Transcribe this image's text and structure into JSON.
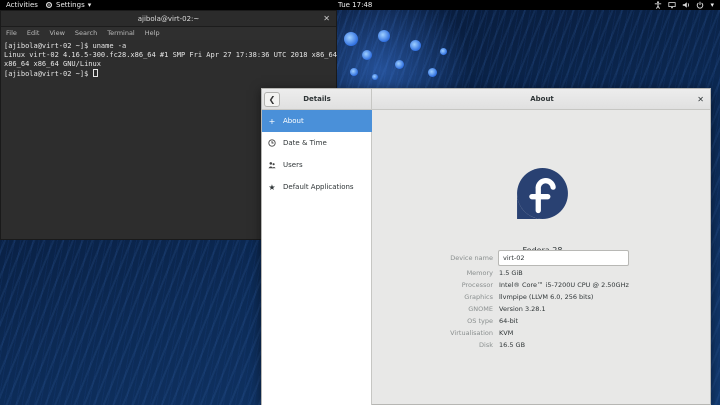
{
  "topbar": {
    "activities": "Activities",
    "app_menu": "Settings",
    "clock": "Tue 17:48"
  },
  "terminal": {
    "title": "ajibola@virt-02:~",
    "menu": [
      "File",
      "Edit",
      "View",
      "Search",
      "Terminal",
      "Help"
    ],
    "lines": [
      "[ajibola@virt-02 ~]$ uname -a",
      "Linux virt-02 4.16.5-300.fc28.x86_64 #1 SMP Fri Apr 27 17:38:36 UTC 2018 x86_64",
      "x86_64 x86_64 GNU/Linux",
      "[ajibola@virt-02 ~]$ "
    ]
  },
  "settings": {
    "left_title": "Details",
    "title": "About",
    "sidebar": [
      {
        "label": "About",
        "icon": "plus-icon",
        "active": true
      },
      {
        "label": "Date & Time",
        "icon": "clock-icon",
        "active": false
      },
      {
        "label": "Users",
        "icon": "users-icon",
        "active": false
      },
      {
        "label": "Default Applications",
        "icon": "star-icon",
        "active": false
      }
    ],
    "distro_name": "Fedora 28",
    "device_name_label": "Device name",
    "device_name_value": "virt-02",
    "info": [
      {
        "label": "Memory",
        "value": "1.5 GiB"
      },
      {
        "label": "Processor",
        "value": "Intel® Core™ i5-7200U CPU @ 2.50GHz"
      },
      {
        "label": "Graphics",
        "value": "llvmpipe (LLVM 6.0, 256 bits)"
      },
      {
        "label": "GNOME",
        "value": "Version 3.28.1"
      },
      {
        "label": "OS type",
        "value": "64-bit"
      },
      {
        "label": "Virtualisation",
        "value": "KVM"
      },
      {
        "label": "Disk",
        "value": "16.5 GB"
      }
    ]
  },
  "colors": {
    "accent": "#4a90d9",
    "fedora_blue": "#294172",
    "terminal_bg": "#2d2d2d"
  }
}
